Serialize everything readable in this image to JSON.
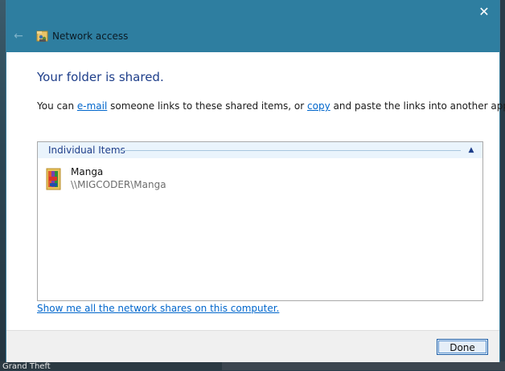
{
  "window": {
    "title": "Network access",
    "close_glyph": "✕",
    "back_glyph": "←",
    "title_icon": "network-share-icon"
  },
  "content": {
    "heading": "Your folder is shared.",
    "desc_prefix": "You can ",
    "email_link": "e-mail",
    "desc_middle": " someone links to these shared items, or ",
    "copy_link": "copy",
    "desc_suffix": " and paste the links into another app."
  },
  "items_panel": {
    "group_label": "Individual Items",
    "chevron_glyph": "▲",
    "items": [
      {
        "name": "Manga",
        "path": "\\\\MIGCODER\\Manga",
        "icon": "folder-icon"
      }
    ]
  },
  "shares_link": "Show me all the network shares on this computer.",
  "footer": {
    "done_label": "Done"
  },
  "taskbar": {
    "text": "Grand Theft"
  },
  "colors": {
    "titlebar": "#2e7ea0",
    "heading": "#1e3e8a",
    "link": "#0066cc",
    "group_header_bg": "#eaf4fc"
  }
}
